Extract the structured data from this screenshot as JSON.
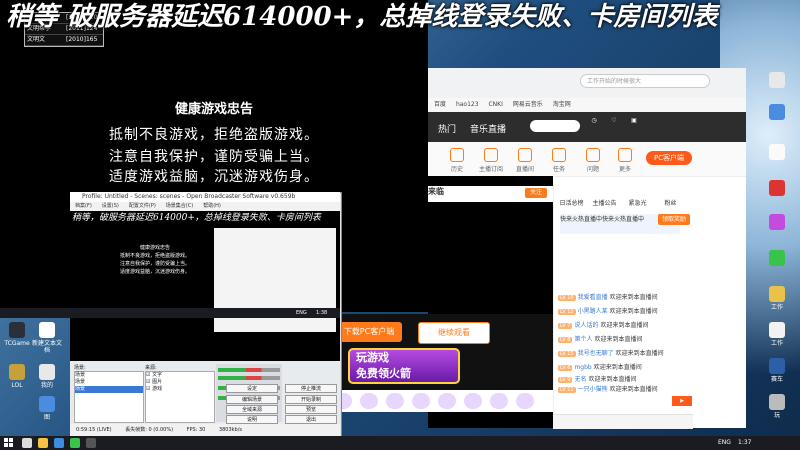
{
  "banner": {
    "prefix": "稍等",
    "text": "破服务器延迟614000+，总掉线登录失败、卡房间列表"
  },
  "overlay_table": [
    {
      "k": "",
      "v": "[2000]910"
    },
    {
      "k": "文明帮手",
      "v": "[2011]124"
    },
    {
      "k": "文明文",
      "v": "[2010]165"
    }
  ],
  "game_warning": {
    "title": "健康游戏忠告",
    "lines": [
      "抵制不良游戏，拒绝盗版游戏。",
      "注意自我保护，谨防受骗上当。",
      "适度游戏益脑，沉迷游戏伤身。"
    ]
  },
  "obs": {
    "title": "Profile: Untitled - Scenes: scenes - Open Broadcaster Software v0.659b",
    "menu": [
      "档案(F)",
      "设置(S)",
      "配置文件(P)",
      "场景集合(C)",
      "帮助(H)"
    ],
    "banner": "稍等，破服务器延迟614000+，总掉线登录失败、卡房间列表",
    "scenes_label": "场景:",
    "sources_label": "来源:",
    "scenes": [
      "场景",
      "场景",
      "场景"
    ],
    "sources": [
      "文字",
      "图片",
      "游戏"
    ],
    "buttons": [
      "设定",
      "停止推流",
      "编辑场景",
      "开始录制",
      "全域来源",
      "预览",
      "说明",
      "退出"
    ],
    "status": [
      "0:59:15 (LIVE)",
      "丢失帧数: 0 (0.00%)",
      "FPS: 30",
      "3803kb/s"
    ]
  },
  "browser": {
    "url": "工作开始的时候很大",
    "bookmarks": [
      "百度",
      "hao123",
      "CNKI",
      "网易云音乐",
      "淘宝网"
    ],
    "nav": [
      "热门",
      "音乐直播"
    ],
    "nav_button": "PC客户端",
    "sub_icons": [
      "历史",
      "主播订阅",
      "直播间",
      "任务",
      "问题",
      "更多"
    ],
    "video_title": "来临",
    "follow": "关注",
    "chat_tabs": [
      "日活总榜",
      "主播公告",
      "紧急光",
      "粉丝"
    ],
    "hot_notice": "快来火热直播中快来火热直播中",
    "hot_button": "领取奖励",
    "chat": [
      {
        "lv": "LV 10",
        "user": "我爱看直播",
        "msg": "欢迎来到本直播间"
      },
      {
        "lv": "LV 12",
        "user": "小黑路人某",
        "msg": "欢迎来到本直播间"
      },
      {
        "lv": "LV 7",
        "user": "说人话的",
        "msg": "欢迎来到本直播间"
      },
      {
        "lv": "LV 8",
        "user": "第个人",
        "msg": "欢迎来到本直播间"
      },
      {
        "lv": "LV 15",
        "user": "我号也无聊了",
        "msg": "欢迎来到本直播间"
      },
      {
        "lv": "LV 6",
        "user": "mgbb",
        "msg": "欢迎来到本直播间"
      },
      {
        "lv": "LV 9",
        "user": "无名",
        "msg": "欢迎来到本直播间"
      },
      {
        "lv": "LV 11",
        "user": "一只小猫熊",
        "msg": "欢迎来到本直播间"
      }
    ],
    "download_client": "下载PC客户端",
    "continue_watch": "继续观看",
    "free_game_1": "玩游戏",
    "free_game_2": "免费领火箭"
  },
  "desktop_icons_left": [
    "TCGame",
    "新建文本文档",
    "LOL",
    "我的",
    "图"
  ],
  "desktop_icons_right": [
    "",
    "",
    "",
    "",
    "",
    "",
    "工作",
    "工作",
    "赛车",
    "玩"
  ],
  "taskbar": {
    "lang": "ENG",
    "time": "1:37"
  },
  "taskbar_inner": {
    "lang": "ENG",
    "time": "1:38"
  }
}
